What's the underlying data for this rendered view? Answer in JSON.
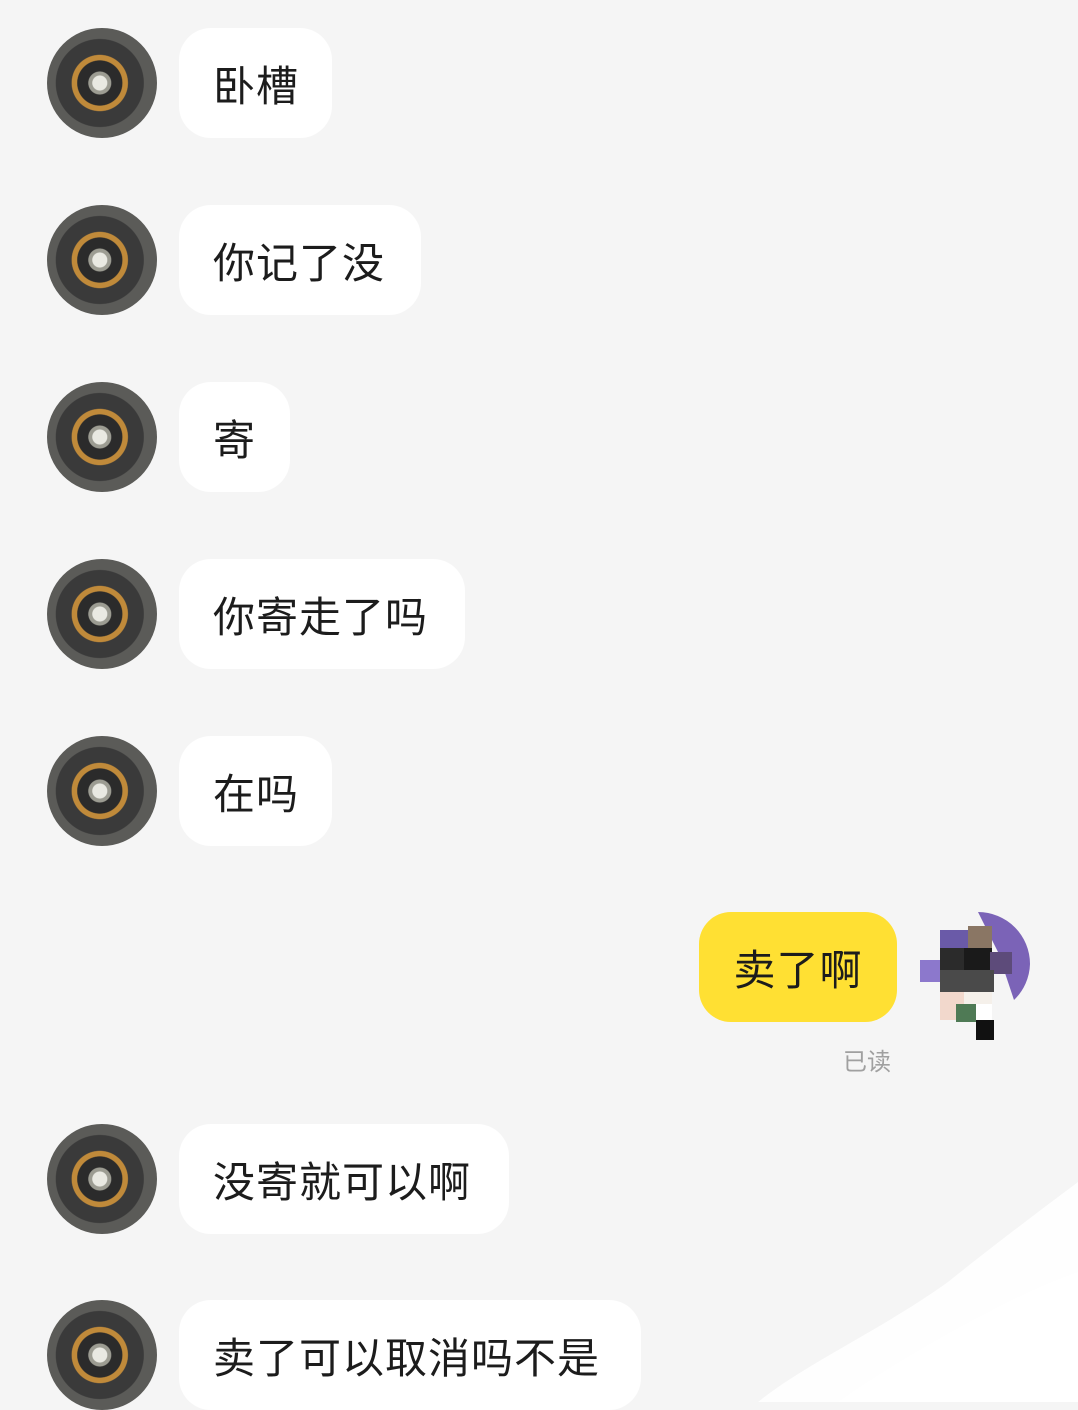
{
  "messages": [
    {
      "side": "in",
      "text": "卧槽"
    },
    {
      "side": "in",
      "text": "你记了没"
    },
    {
      "side": "in",
      "text": "寄"
    },
    {
      "side": "in",
      "text": "你寄走了吗"
    },
    {
      "side": "in",
      "text": "在吗"
    },
    {
      "side": "out",
      "text": "卖了啊",
      "status": "已读"
    },
    {
      "side": "in",
      "text": "没寄就可以啊"
    },
    {
      "side": "in",
      "text": "卖了可以取消吗不是"
    }
  ],
  "colors": {
    "background": "#f5f5f5",
    "incoming_bubble": "#ffffff",
    "outgoing_bubble": "#ffe033",
    "text": "#1c1c1c",
    "status_text": "#a0a0a0"
  },
  "icons": {
    "contact_avatar": "camera-lens-avatar-icon",
    "self_avatar": "pixelated-avatar-icon"
  }
}
